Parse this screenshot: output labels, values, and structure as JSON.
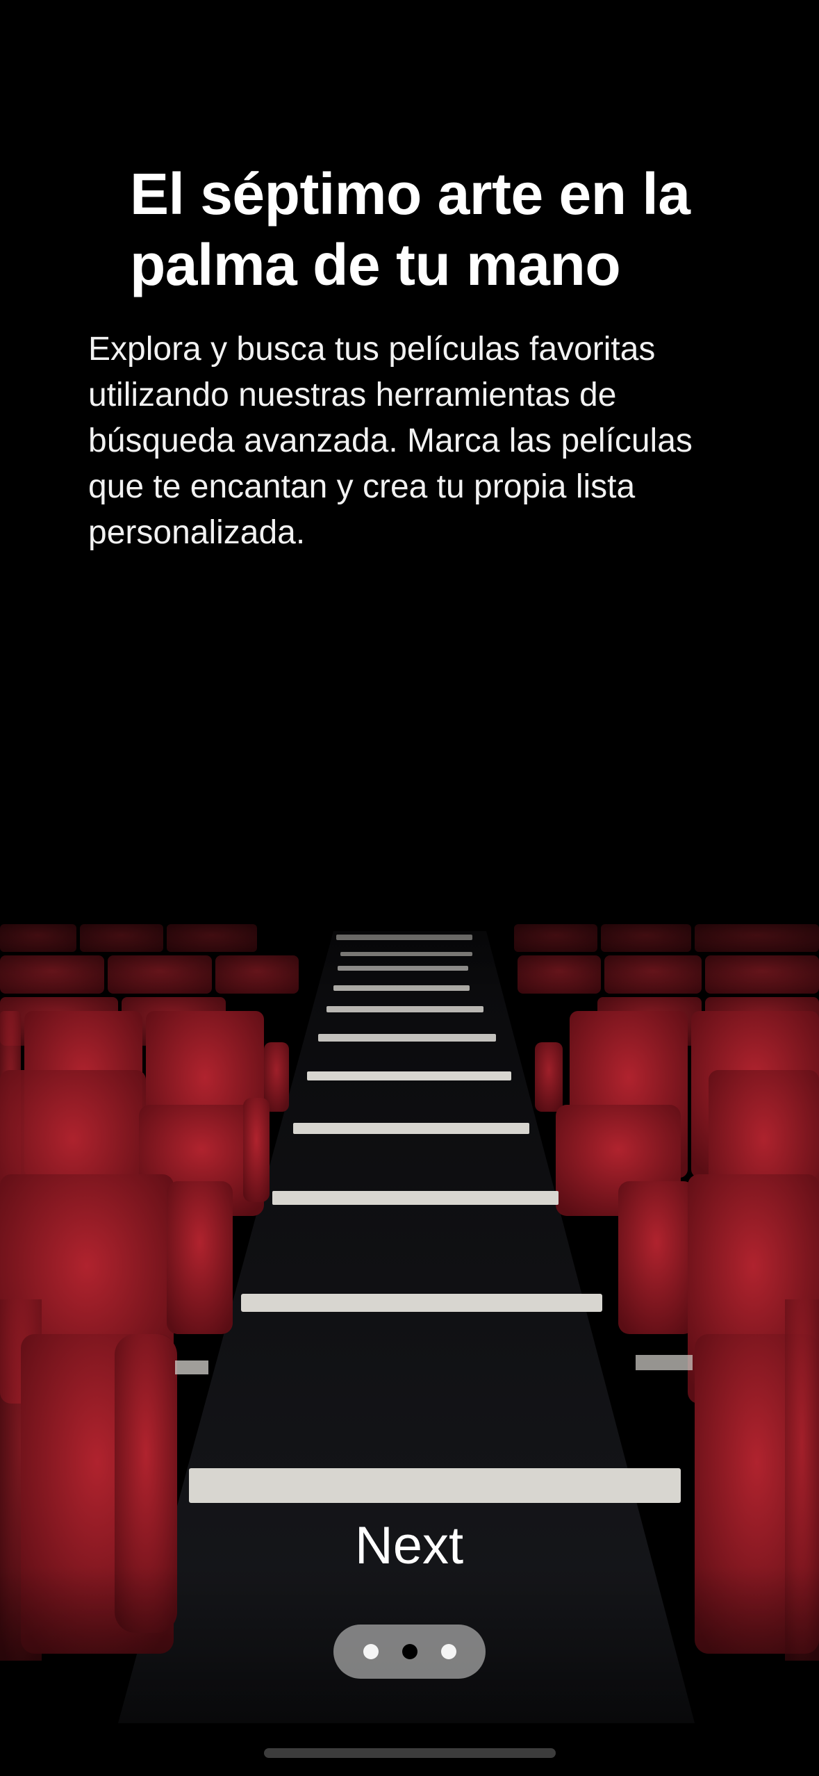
{
  "onboarding": {
    "title": "El séptimo arte en la palma de tu mano",
    "description": "Explora y busca tus películas favoritas utilizando nuestras herramientas de búsqueda avanzada. Marca las películas que te encantan y crea tu propia lista personalizada.",
    "background_image": "cinema-seats-illustration",
    "next_label": "Next",
    "page_indicator": {
      "total_pages": 3,
      "current_page": 2
    }
  },
  "colors": {
    "background": "#000000",
    "seat_red": "#9b1a24",
    "text": "#ffffff"
  }
}
